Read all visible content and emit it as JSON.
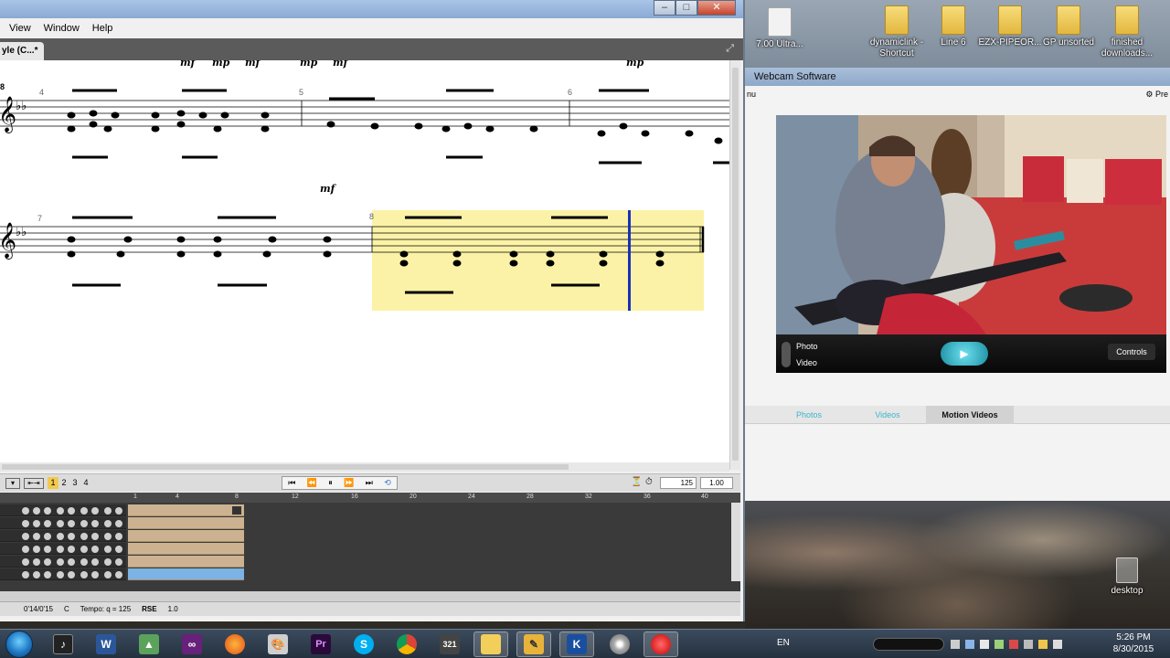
{
  "gp": {
    "menu": [
      "View",
      "Window",
      "Help"
    ],
    "tab_label": "yle (C...*",
    "toolbar": {
      "pages": [
        "1",
        "2",
        "3",
        "4"
      ],
      "tempo_value": "125",
      "speed_value": "1.00"
    },
    "ruler": [
      "1",
      "4",
      "8",
      "12",
      "16",
      "20",
      "24",
      "28",
      "32",
      "36",
      "40"
    ],
    "status": {
      "time": "0'14/0'15",
      "key": "C",
      "tempo": "Tempo: q = 125",
      "rse": "RSE",
      "rse_val": "1.0"
    },
    "score": {
      "dynamics_row1": [
        "mf",
        "mp",
        "mf",
        "mp",
        "mf",
        "mp"
      ],
      "dynamics_row2": [
        "mf"
      ],
      "measures": [
        "4",
        "5",
        "6",
        "7",
        "8"
      ],
      "system_number": "8"
    }
  },
  "webcam": {
    "title": "Webcam Software",
    "side_label": "nu",
    "prefs": "Pre",
    "modes": [
      "Photo",
      "Video"
    ],
    "controls_label": "Controls",
    "tabs": [
      "Photos",
      "Videos",
      "Motion Videos"
    ]
  },
  "desktop": {
    "icons": [
      {
        "label": "7.00 Ultra...",
        "type": "file"
      },
      {
        "label": "dynamiclink - Shortcut",
        "type": "folder"
      },
      {
        "label": "Line 6",
        "type": "folder"
      },
      {
        "label": "EZX-PIPEOR...",
        "type": "folder"
      },
      {
        "label": "GP unsorted",
        "type": "folder"
      },
      {
        "label": "finished downloads...",
        "type": "folder"
      }
    ],
    "trash_label": "desktop"
  },
  "taskbar": {
    "lang": "EN",
    "time": "5:26 PM",
    "date": "8/30/2015"
  },
  "colors": {
    "selection": "#fbf2a7",
    "cursor": "#1c2fb8",
    "accent": "#3bb6c9"
  }
}
